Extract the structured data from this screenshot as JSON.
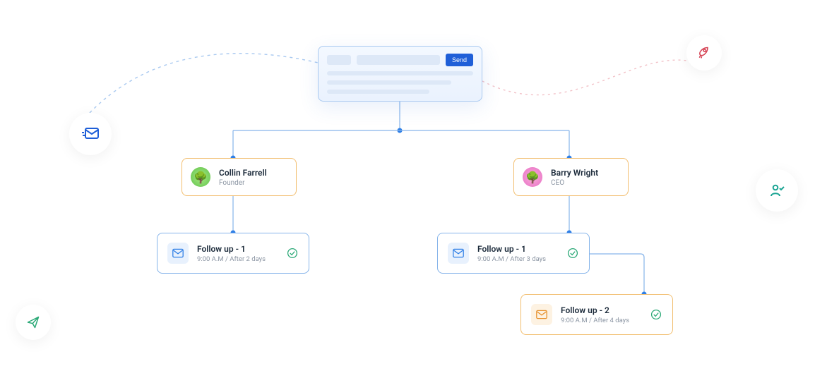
{
  "compose": {
    "send_label": "Send"
  },
  "contacts": {
    "left": {
      "name": "Collin Farrell",
      "role": "Founder"
    },
    "right": {
      "name": "Barry Wright",
      "role": "CEO"
    }
  },
  "followups": {
    "left_1": {
      "title": "Follow up - 1",
      "meta": "9:00 A.M / After 2 days"
    },
    "right_1": {
      "title": "Follow up - 1",
      "meta": "9:00 A.M / After 3 days"
    },
    "right_2": {
      "title": "Follow up - 2",
      "meta": "9:00 A.M / After 4 days"
    }
  },
  "colors": {
    "blue_border": "#86b4ea",
    "orange_border": "#f2be6f",
    "primary_blue": "#1f5fd8",
    "check_green": "#2aa876",
    "rocket_red": "#d43d4f",
    "teal": "#1aa493"
  },
  "icons": {
    "mail_fast": "mail-fast-icon",
    "rocket": "rocket-icon",
    "paper_plane": "paper-plane-icon",
    "user_check": "user-check-icon",
    "envelope": "envelope-icon",
    "check_circle": "check-circle-icon"
  }
}
